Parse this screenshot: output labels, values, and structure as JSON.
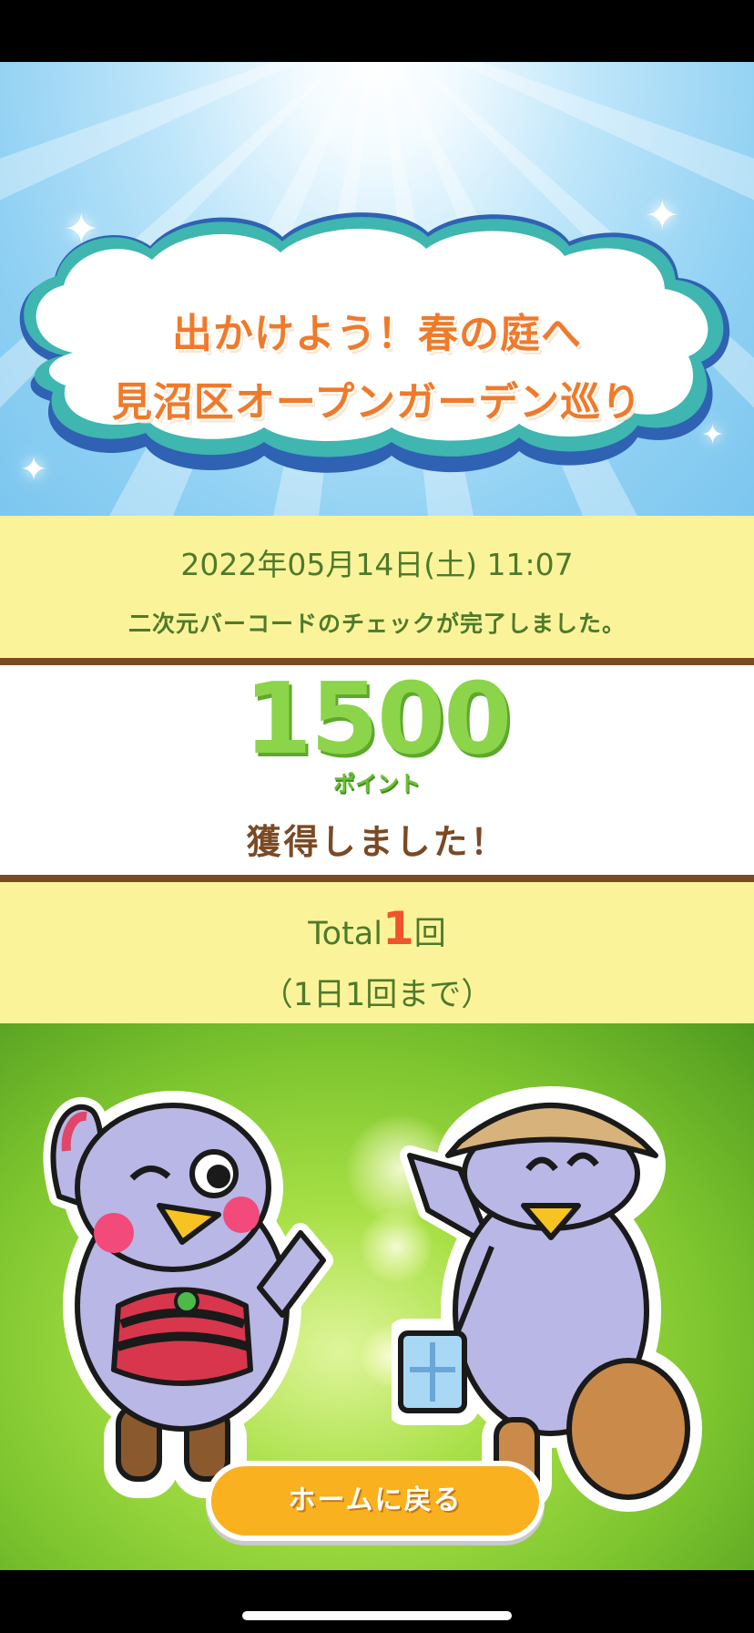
{
  "header": {
    "title_line1": "出かけよう！春の庭へ",
    "title_line2": "見沼区オープンガーデン巡り"
  },
  "result": {
    "datetime": "2022年05月14日(土) 11:07",
    "message": "二次元バーコードのチェックが完了しました。"
  },
  "points": {
    "value": "1500",
    "unit": "ポイント",
    "gained": "獲得しました！"
  },
  "tally": {
    "total_label": "Total",
    "total_count": "1",
    "total_suffix": "回",
    "limit": "（1日1回まで）"
  },
  "footer": {
    "home_button": "ホームに戻る"
  },
  "icons": [
    "sparkle-icon",
    "cloud-frame",
    "mascot-bird-left",
    "mascot-bird-right"
  ],
  "colors": {
    "title_orange": "#f07a2a",
    "points_green": "#8cd44a",
    "band_yellow": "#fbf39a",
    "divider_brown": "#7a4a24",
    "button_orange": "#f9b11f",
    "count_red": "#f0542a"
  }
}
